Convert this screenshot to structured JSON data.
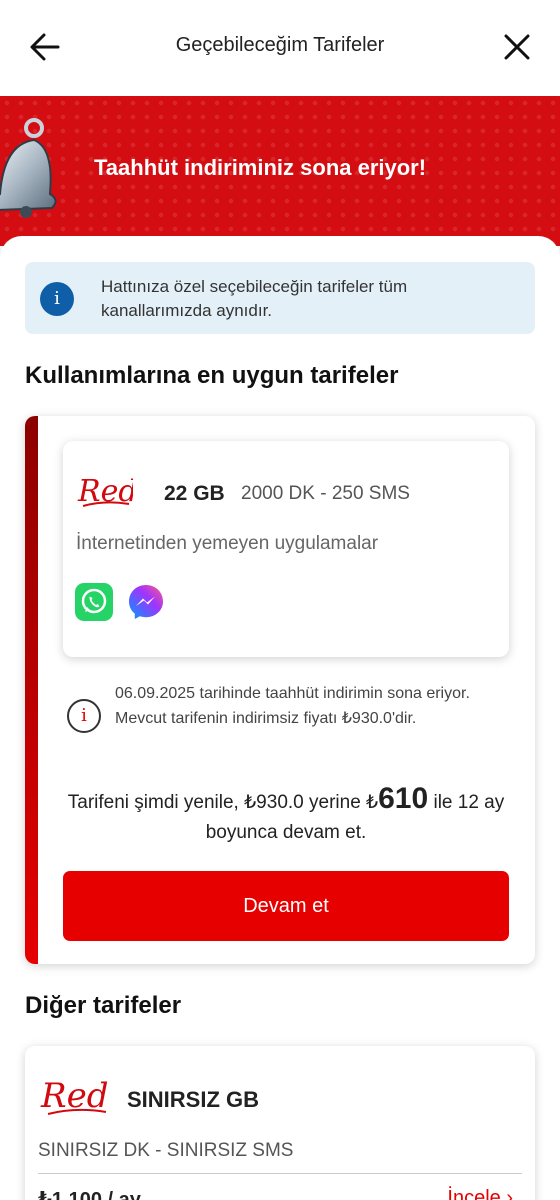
{
  "header": {
    "title": "Geçebileceğim Tarifeler"
  },
  "banner": {
    "text": "Taahhüt indiriminiz sona eriyor!"
  },
  "info": {
    "text": "Hattınıza özel seçebileceğin tarifeler tüm kanallarımızda aynıdır."
  },
  "sections": {
    "recommended_title": "Kullanımlarına en uygun tarifeler",
    "other_title": "Diğer tarifeler"
  },
  "recommended_plan": {
    "logo_text": "Red",
    "data": "22 GB",
    "minutes_sms": "2000 DK - 250 SMS",
    "apps_label": "İnternetinden yemeyen uygulamalar",
    "apps": [
      "whatsapp-icon",
      "messenger-icon"
    ],
    "warning": "06.09.2025 tarihinde taahhüt indirimin sona eriyor. Mevcut tarifenin indirimsiz fiyatı ₺930.0'dir.",
    "offer_prefix": "Tarifeni şimdi yenile, ₺930.0 yerine ₺",
    "offer_price": "610",
    "offer_suffix": " ile 12 ay boyunca devam et.",
    "cta_label": "Devam et"
  },
  "other_plan": {
    "logo_text": "Red",
    "data": "SINIRSIZ GB",
    "minutes_sms": "SINIRSIZ DK - SINIRSIZ SMS",
    "price": "₺1.100 / ay",
    "more_label": "İncele"
  },
  "colors": {
    "brand_red": "#e60000",
    "banner_red": "#d40d12",
    "info_bg": "#e3f0f8",
    "info_icon": "#0e5fa7"
  }
}
